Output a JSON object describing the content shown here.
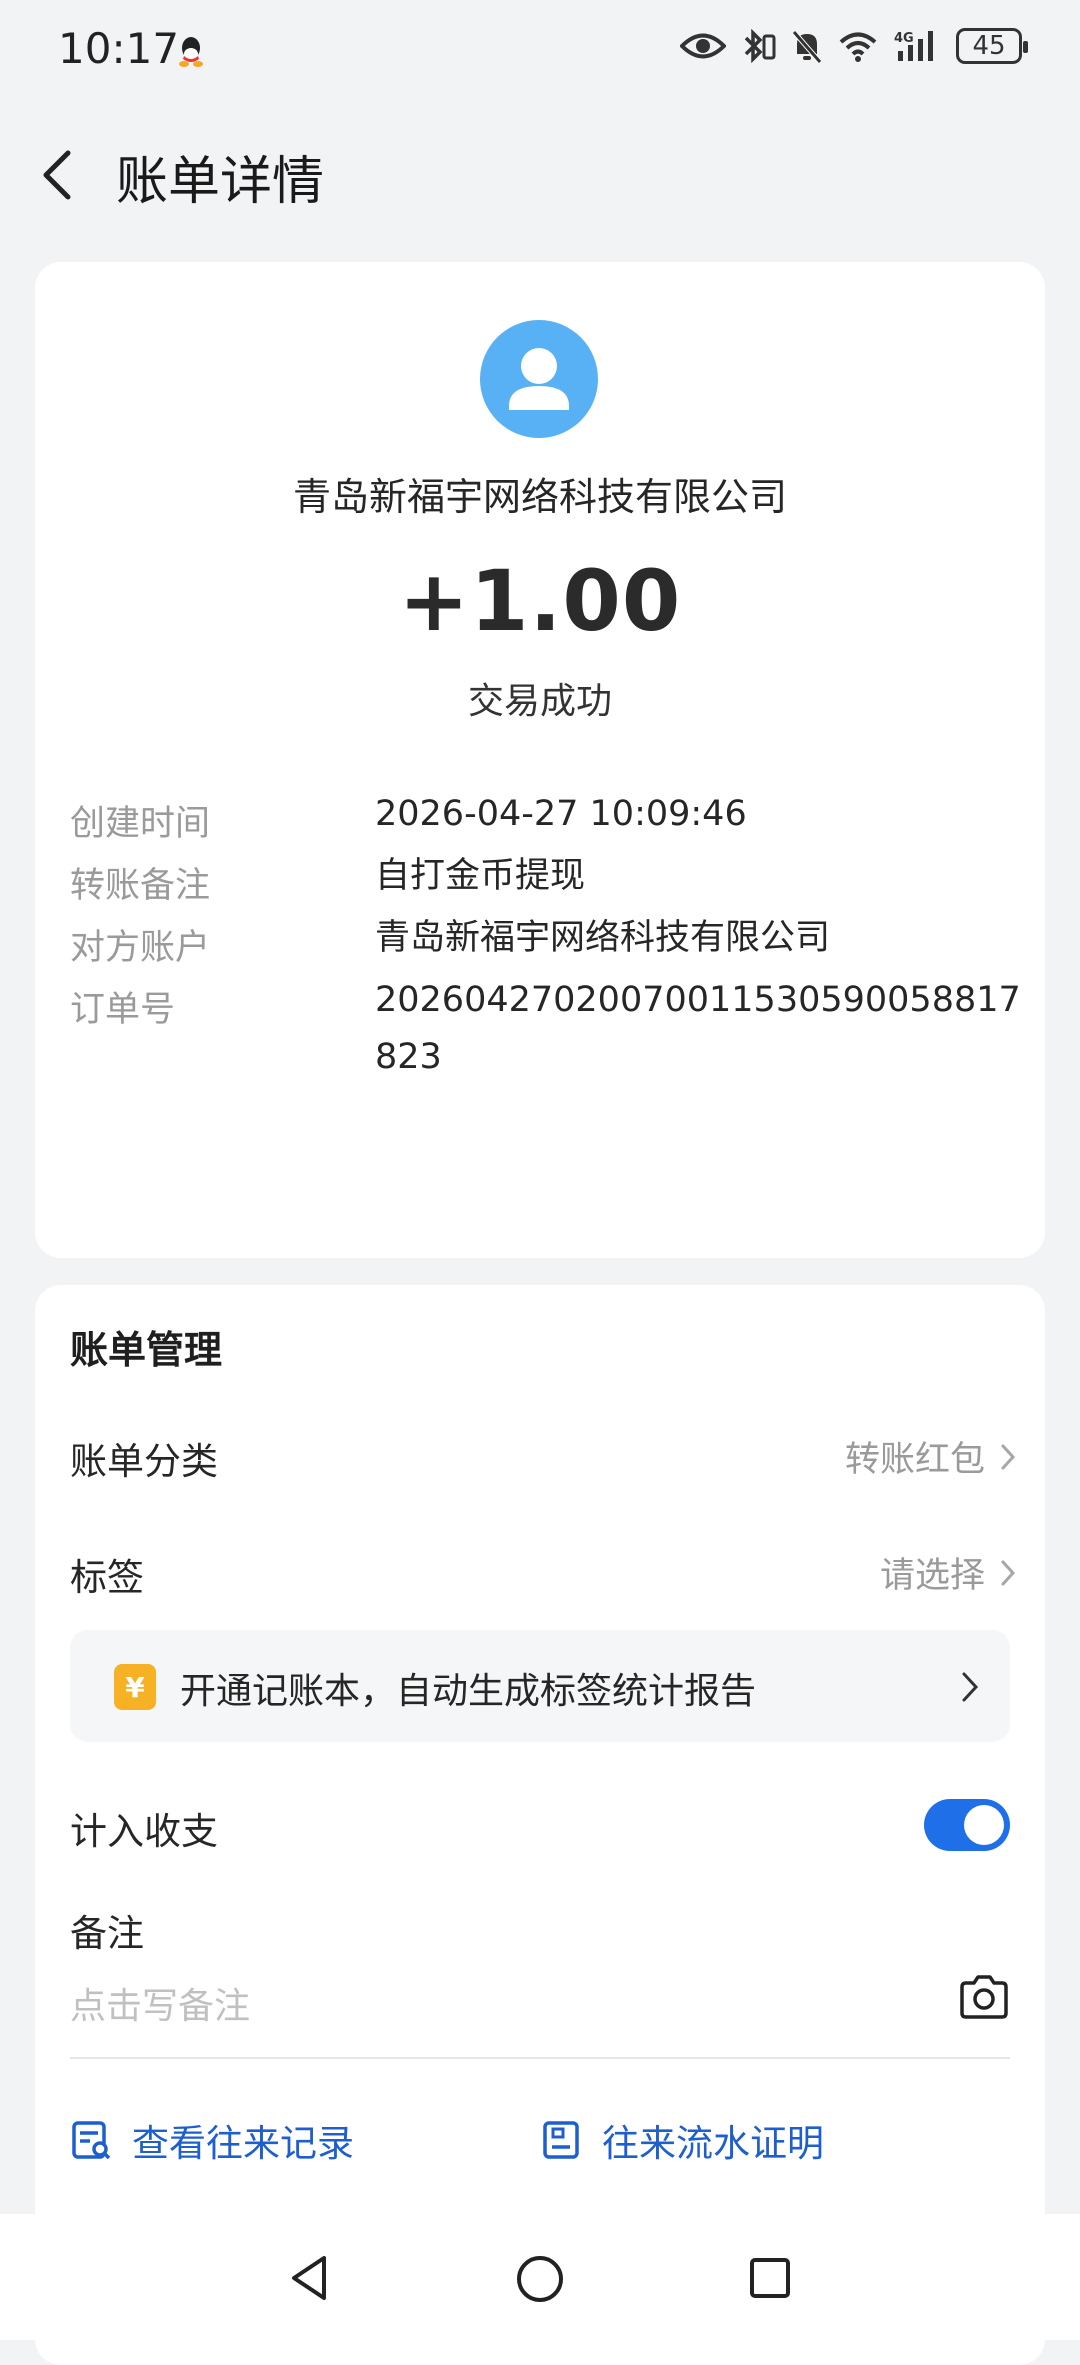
{
  "status_bar": {
    "time": "10:17",
    "battery": "45",
    "icons": [
      "qq-icon",
      "eye-icon",
      "bluetooth-icon",
      "mute-icon",
      "wifi-icon",
      "signal-4g-icon",
      "battery-icon"
    ]
  },
  "header": {
    "title": "账单详情"
  },
  "summary": {
    "merchant": "青岛新福宇网络科技有限公司",
    "amount": "+1.00",
    "status": "交易成功"
  },
  "details": [
    {
      "label": "创建时间",
      "value": "2026-04-27 10:09:46"
    },
    {
      "label": "转账备注",
      "value": "自打金币提现"
    },
    {
      "label": "对方账户",
      "value": "青岛新福宇网络科技有限公司"
    },
    {
      "label": "订单号",
      "value": "20260427020070011530590058817823"
    }
  ],
  "management": {
    "title": "账单管理",
    "category_label": "账单分类",
    "category_value": "转账红包",
    "tag_label": "标签",
    "tag_value": "请选择",
    "promo_icon_text": "¥",
    "promo_text": "开通记账本，自动生成标签统计报告",
    "count_label": "计入收支",
    "count_enabled": true,
    "note_label": "备注",
    "note_placeholder": "点击写备注",
    "link_history": "查看往来记录",
    "link_proof": "往来流水证明"
  },
  "colors": {
    "accent": "#1e6fe8",
    "link": "#1e5fcf",
    "avatar": "#58b1f5",
    "promo_icon": "#f7b125"
  }
}
